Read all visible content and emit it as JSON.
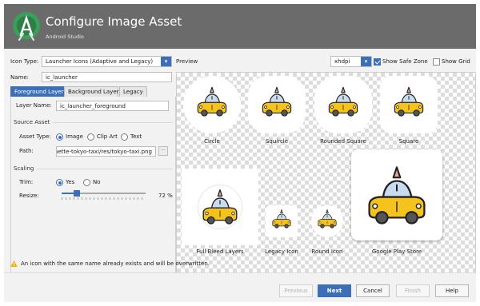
{
  "header": {
    "title": "Configure Image Asset",
    "subtitle": "Android Studio"
  },
  "icon_type": {
    "label": "Icon Type:",
    "value": "Launcher Icons (Adaptive and Legacy)"
  },
  "name": {
    "label": "Name:",
    "value": "ic_launcher"
  },
  "tabs": [
    {
      "label": "Foreground Layer",
      "active": true
    },
    {
      "label": "Background Layer",
      "active": false
    },
    {
      "label": "Legacy",
      "active": false
    }
  ],
  "foreground": {
    "layer_name_label": "Layer Name:",
    "layer_name_value": "ic_launcher_foreground",
    "source_asset_title": "Source Asset",
    "asset_type_label": "Asset Type:",
    "asset_types": [
      "Image",
      "Clip Art",
      "Text"
    ],
    "asset_type_selected": "Image",
    "path_label": "Path:",
    "path_value": "nette-tokyo-taxi/res/tokyo-taxi.png",
    "scaling_title": "Scaling",
    "trim_label": "Trim:",
    "trim_options": [
      "Yes",
      "No"
    ],
    "trim_selected": "Yes",
    "resize_label": "Resize:",
    "resize_value": "72 %",
    "resize_percent": 72
  },
  "preview": {
    "label": "Preview",
    "density": "xhdpi",
    "show_safe_zone_label": "Show Safe Zone",
    "show_safe_zone": true,
    "show_grid_label": "Show Grid",
    "show_grid": false,
    "icons": [
      {
        "caption": "Circle"
      },
      {
        "caption": "Squircle"
      },
      {
        "caption": "Rounded Square"
      },
      {
        "caption": "Square"
      },
      {
        "caption": "Full Bleed Layers"
      },
      {
        "caption": "Legacy Icon"
      },
      {
        "caption": "Round Icon"
      },
      {
        "caption": "Google Play Store"
      }
    ]
  },
  "warning": "An icon with the same name already exists and will be overwritten.",
  "footer": {
    "previous": "Previous",
    "next": "Next",
    "cancel": "Cancel",
    "finish": "Finish",
    "help": "Help"
  },
  "colors": {
    "accent": "#3d6fb6",
    "header": "#6b6b6b",
    "taxi_body": "#f6c21c",
    "taxi_window": "#c9dcef",
    "taxi_sign": "#f0a393"
  }
}
